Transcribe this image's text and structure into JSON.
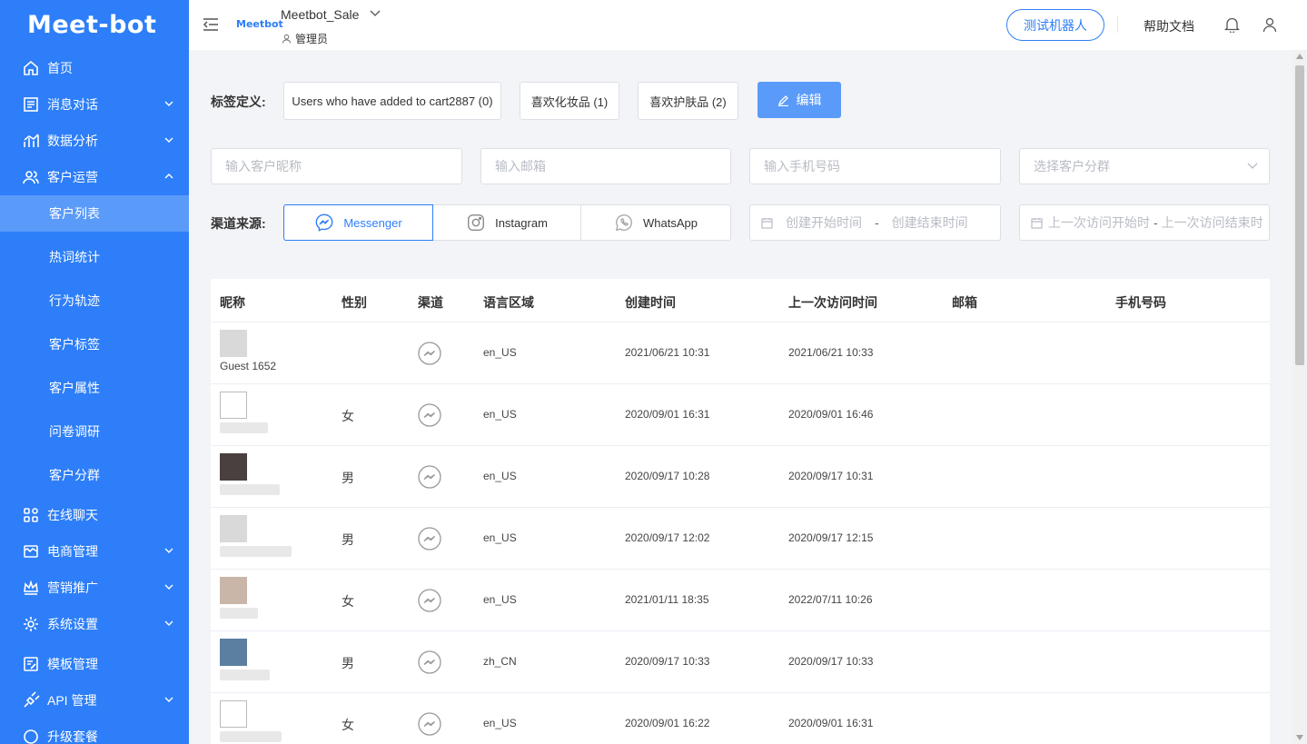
{
  "app": {
    "logo": "Meet-bot"
  },
  "header": {
    "brand_mini": "Meetbot",
    "account_name": "Meetbot_Sale",
    "role": "管理员",
    "test_bot": "测试机器人",
    "help_docs": "帮助文档"
  },
  "sidebar": {
    "home": "首页",
    "messages": "消息对话",
    "analytics": "数据分析",
    "customer_ops": "客户运营",
    "customer_list": "客户列表",
    "hot_words": "热词统计",
    "behavior": "行为轨迹",
    "customer_tags": "客户标签",
    "customer_attrs": "客户属性",
    "survey": "问卷调研",
    "segments": "客户分群",
    "live_chat": "在线聊天",
    "ecommerce": "电商管理",
    "marketing": "营销推广",
    "settings": "系统设置",
    "templates": "模板管理",
    "api": "API 管理",
    "upgrade": "升级套餐"
  },
  "filters": {
    "tag_label": "标签定义:",
    "tags": [
      "Users who have added to cart2887 (0)",
      "喜欢化妆品 (1)",
      "喜欢护肤品 (2)"
    ],
    "edit": "编辑",
    "nickname_ph": "输入客户昵称",
    "email_ph": "输入邮箱",
    "phone_ph": "输入手机号码",
    "segment_ph": "选择客户分群",
    "channel_label": "渠道来源:",
    "channels": [
      "Messenger",
      "Instagram",
      "WhatsApp"
    ],
    "created_start": "创建开始时间",
    "created_end": "创建结束时间",
    "visit_start": "上一次访问开始时",
    "visit_end": "上一次访问结束时",
    "range_sep": "-"
  },
  "table": {
    "headers": [
      "昵称",
      "性别",
      "渠道",
      "语言区域",
      "创建时间",
      "上一次访问时间",
      "邮箱",
      "手机号码"
    ],
    "rows": [
      {
        "nickname": "Guest 1652",
        "gender": "",
        "locale": "en_US",
        "created": "2021/06/21 10:31",
        "last_visit": "2021/06/21 10:33"
      },
      {
        "nickname": "",
        "gender": "女",
        "locale": "en_US",
        "created": "2020/09/01 16:31",
        "last_visit": "2020/09/01 16:46"
      },
      {
        "nickname": "",
        "gender": "男",
        "locale": "en_US",
        "created": "2020/09/17 10:28",
        "last_visit": "2020/09/17 10:31"
      },
      {
        "nickname": "",
        "gender": "男",
        "locale": "en_US",
        "created": "2020/09/17 12:02",
        "last_visit": "2020/09/17 12:15"
      },
      {
        "nickname": "",
        "gender": "女",
        "locale": "en_US",
        "created": "2021/01/11 18:35",
        "last_visit": "2022/07/11 10:26"
      },
      {
        "nickname": "",
        "gender": "男",
        "locale": "zh_CN",
        "created": "2020/09/17 10:33",
        "last_visit": "2020/09/17 10:33"
      },
      {
        "nickname": "",
        "gender": "女",
        "locale": "en_US",
        "created": "2020/09/01 16:22",
        "last_visit": "2020/09/01 16:31"
      }
    ]
  },
  "colors": {
    "primary": "#2d7ef8",
    "sidebar_active": "#5a9bfa"
  }
}
